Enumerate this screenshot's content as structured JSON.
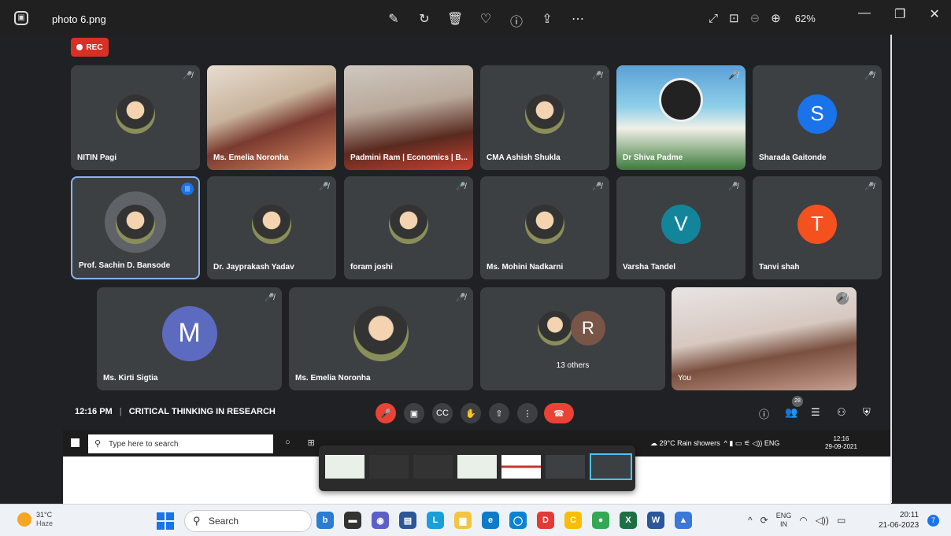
{
  "viewer": {
    "file_name": "photo 6.png",
    "zoom": "62%",
    "toolbar_icons": [
      "edit-icon",
      "rotate-icon",
      "delete-icon",
      "heart-icon",
      "info-icon",
      "share-icon",
      "more-icon"
    ]
  },
  "meet": {
    "rec_label": "REC",
    "tiles": [
      {
        "name": "NITIN Pagi"
      },
      {
        "name": "Ms. Emelia Noronha"
      },
      {
        "name": "Padmini Ram | Economics | B..."
      },
      {
        "name": "CMA Ashish Shukla"
      },
      {
        "name": "Dr Shiva Padme"
      },
      {
        "name": "Sharada Gaitonde",
        "initial": "S",
        "color": "#1a73e8"
      },
      {
        "name": "Prof. Sachin D. Bansode"
      },
      {
        "name": "Dr. Jayprakash Yadav"
      },
      {
        "name": "foram joshi"
      },
      {
        "name": "Ms. Mohini Nadkarni"
      },
      {
        "name": "Varsha Tandel",
        "initial": "V",
        "color": "#12859a"
      },
      {
        "name": "Tanvi shah",
        "initial": "T",
        "color": "#f4511e"
      },
      {
        "name": "Ms. Kirti Sigtia",
        "initial": "M",
        "color": "#5c6bc0"
      },
      {
        "name": "Ms. Emelia Noronha"
      },
      {
        "name": "You"
      }
    ],
    "others": {
      "label": "13 others",
      "initial": "R",
      "color": "#795548"
    },
    "time": "12:16 PM",
    "separator": "|",
    "meeting_title": "CRITICAL THINKING IN RESEARCH",
    "participants_count": "28"
  },
  "inner_taskbar": {
    "search_placeholder": "Type here to search",
    "weather": "29°C  Rain showers",
    "lang": "ENG",
    "time": "12:16",
    "date": "29-09-2021"
  },
  "taskbar": {
    "temp": "31°C",
    "condition": "Haze",
    "search": "Search",
    "lang_top": "ENG",
    "lang_bottom": "IN",
    "time": "20:11",
    "date": "21-06-2023",
    "notifications": "7"
  }
}
